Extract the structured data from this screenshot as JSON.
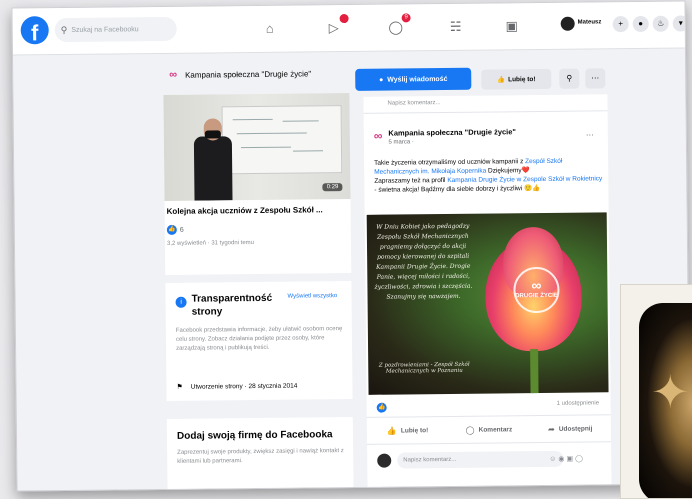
{
  "topbar": {
    "logo": "f",
    "search_placeholder": "Szukaj na Facebooku",
    "nav_badges": {
      "watch": "",
      "marketplace": "9",
      "groups": "9"
    },
    "user_name": "Mateusz"
  },
  "page": {
    "name": "Kampania społeczna \"Drugie życie\""
  },
  "buttons": {
    "send_message": "Wyślij wiadomość",
    "like_page": "Lubię to!"
  },
  "video": {
    "duration": "0:29",
    "title": "Kolejna akcja uczniów z Zespołu Szkół ...",
    "like_count": "6",
    "meta": "3,2 wyświetleń · 31 tygodni temu"
  },
  "transparency": {
    "title": "Transparentność strony",
    "see_all": "Wyświetl wszystko",
    "text": "Facebook przedstawia informacje, żeby ułatwić osobom ocenę celu strony. Zobacz działania podjęte przez osoby, które zarządzają stroną i publikują treści.",
    "created": "Utworzenie strony · 28 stycznia 2014"
  },
  "add_business": {
    "title": "Dodaj swoją firmę do Facebooka",
    "text": "Zaprezentuj swoje produkty, zwiększ zasięgi i nawiąż kontakt z klientami lub partnerami."
  },
  "post": {
    "prev_strip": "Napisz komentarz...",
    "page_name": "Kampania społeczna \"Drugie życie\"",
    "date": "5 marca · ",
    "text_1": "Takie życzenia otrzymaliśmy od uczniów kampanii z ",
    "link_1": "Zespół Szkół Mechanicznych im. Mikołaja Kopernika",
    "text_1_end": " Dziękujemy❤️",
    "text_2": "Zapraszamy też na profil ",
    "link_2": "Kampania Drugie Życie w Zespole Szkół w Rokietnicy",
    "text_2_end": " - świetna akcja! Bądźmy dla siebie dobrzy i życzliwi 🙂👍",
    "image_text": "W Dniu Kobiet jako pedagodzy Zespołu Szkół Mechanicznych pragniemy dołączyć do akcji pomocy kierowanej do szpitali Kampanii Drugie Życie. Drogie Panie, więcej miłości i radości, życzliwości, zdrowia i szczęścia. Szanujmy się nawzajem.",
    "image_signature": "Z pozdrowieniami - Zespół Szkół Mechanicznych w Poznaniu",
    "logo_text": "DRUGIE ŻYCIE",
    "reaction_count": "",
    "comments": "1 udostępnienie",
    "like_action": "Lubię to!",
    "comment_action": "Komentarz",
    "share_action": "Udostępnij",
    "comment_placeholder": "Napisz komentarz..."
  }
}
